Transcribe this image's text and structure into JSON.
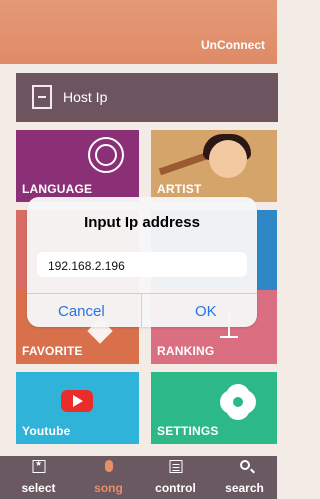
{
  "header": {
    "status": "UnConnect"
  },
  "host": {
    "label": "Host Ip"
  },
  "tiles": {
    "language": "LANGUAGE",
    "artist": "ARTIST",
    "favorite": "FAVORITE",
    "ranking": "RANKING",
    "youtube": "Youtube",
    "settings": "SETTINGS"
  },
  "dialog": {
    "title": "Input Ip address",
    "value": "192.168.2.196",
    "cancel": "Cancel",
    "ok": "OK"
  },
  "bottom_nav": {
    "select": "select",
    "song": "song",
    "control": "control",
    "search": "search"
  },
  "colors": {
    "header": "#e08a66",
    "selected_nav": "#ea8d69",
    "dialog_button": "#2574e8"
  },
  "icons": {
    "host": "host-ip-icon",
    "language": "globe-icon",
    "youtube": "youtube-icon",
    "settings": "gear-icon",
    "select": "select-icon",
    "song": "microphone-icon",
    "control": "control-icon",
    "search": "search-icon"
  }
}
